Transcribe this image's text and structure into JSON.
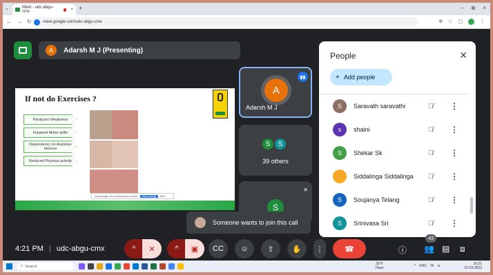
{
  "browser": {
    "tab_title": "Meet - udc-abgu-cmx",
    "tab_close": "×",
    "new_tab": "+",
    "url": "meet.google.com/udc-abgu-cmx",
    "window_controls": [
      "–",
      "⧉",
      "×"
    ]
  },
  "presentation": {
    "presenter_initial": "A",
    "chip_text": "Adarsh M J (Presenting)"
  },
  "slide": {
    "title": "If not do Exercises ?",
    "items": [
      "Paralysis/ Weakness",
      "Impaired Motor skills",
      "Dependency on Assistive devices",
      "Reduced Physical activity"
    ],
    "toast_text": "meet.google.com is sharing your screen.",
    "toast_stop": "Stop sharing",
    "toast_hide": "Hide"
  },
  "tiles": {
    "main_initial": "A",
    "main_name": "Adarsh M J",
    "others_initials": [
      "S",
      "S"
    ],
    "others_label": "39 others",
    "third_initial": "S"
  },
  "toast": {
    "text": "Someone wants to join this call"
  },
  "people_panel": {
    "title": "People",
    "add_people": "Add people",
    "participants": [
      {
        "initial": "S",
        "name": "Saravath saravathi",
        "color": "#8d6e63"
      },
      {
        "initial": "s",
        "name": "shaini",
        "color": "#5e35b1"
      },
      {
        "initial": "S",
        "name": "Shekar Sk",
        "color": "#43a047"
      },
      {
        "initial": "",
        "name": "Siddalinga Siddalinga",
        "color": "#f9a825"
      },
      {
        "initial": "S",
        "name": "Soujanya Telang",
        "color": "#1565c0"
      },
      {
        "initial": "S",
        "name": "Srinivasa Sri",
        "color": "#12939a"
      }
    ]
  },
  "controls": {
    "time": "4:21 PM",
    "meeting_code": "udc-abgu-cmx",
    "people_count": "43"
  },
  "taskbar": {
    "search": "Search",
    "weather_temp": "30°F",
    "weather_desc": "Haze",
    "lang": "ENG",
    "lang_sub": "IN",
    "time": "16:21",
    "date": "22-03-2023"
  }
}
